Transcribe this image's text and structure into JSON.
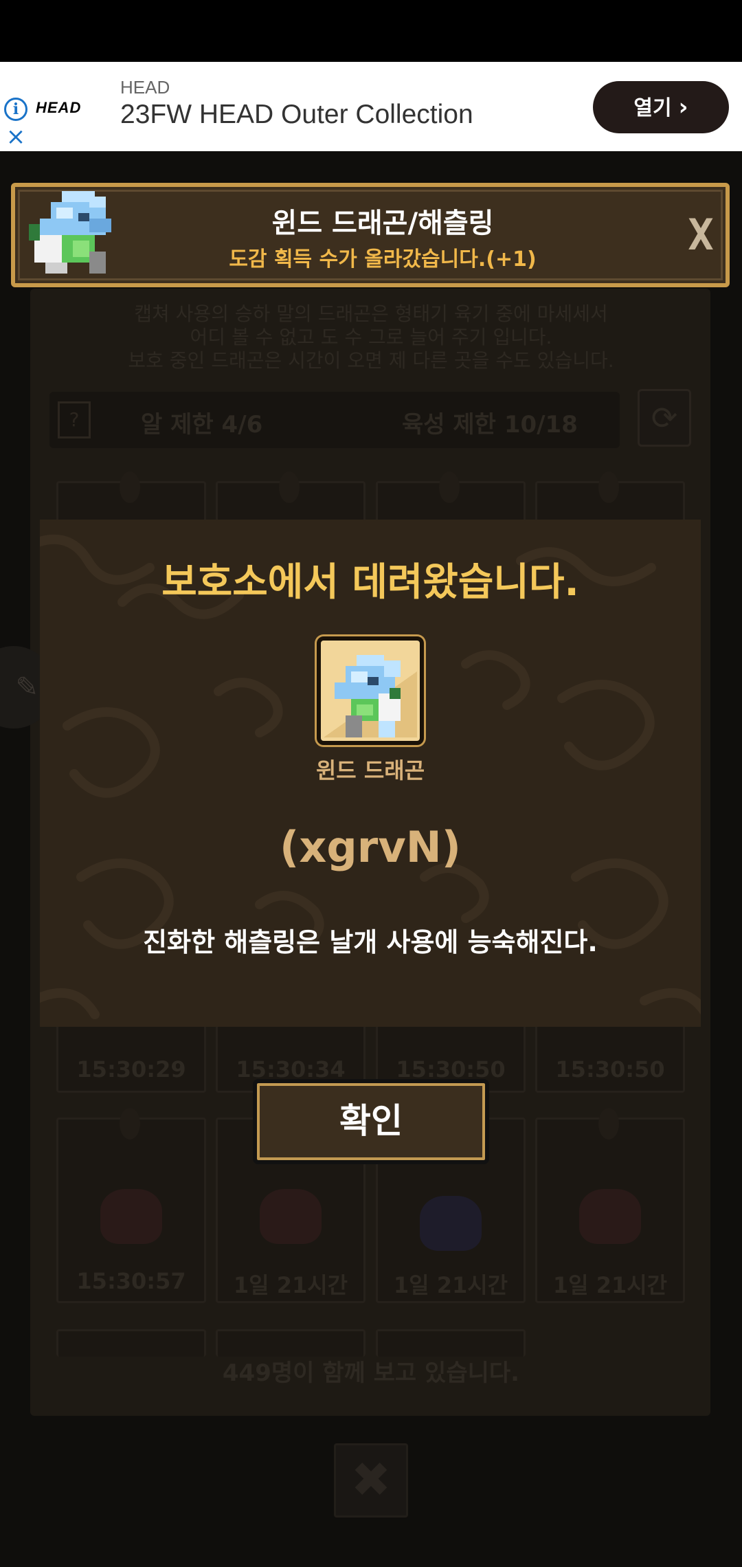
{
  "ad": {
    "brand_small": "HEAD",
    "logo_text": "HEAD",
    "title": "23FW HEAD Outer Collection",
    "cta_label": "열기",
    "info_icon": "info-icon",
    "close_icon": "close-icon"
  },
  "background": {
    "desc_line1": "캡쳐 사용의 승하 말의 드래곤은 형태기 육기 중에 마세세서",
    "desc_line2": "어디 볼 수 없고 도 수 그로 늘어 주기 입니다.",
    "desc_line3": "보호 중인 드래곤은 시간이 오면 제 다른 곳을 수도 있습니다.",
    "stat_egg_label": "알 제한",
    "stat_egg_value": "4/6",
    "stat_raise_label": "육성 제한",
    "stat_raise_value": "10/18",
    "timers_row1": [
      "15:30:29",
      "15:30:34",
      "15:30:50",
      "15:30:50"
    ],
    "timers_row2": [
      "15:30:57",
      "1일 21시간",
      "1일 21시간",
      "1일 21시간"
    ],
    "viewers": "449명이 함께 보고 있습니다."
  },
  "toast": {
    "title": "윈드 드래곤/해츨링",
    "subtitle": "도감 획득 수가 올라갔습니다.(+1)",
    "close_label": "X"
  },
  "modal": {
    "title": "보호소에서 데려왔습니다.",
    "dragon_name": "윈드 드래곤",
    "dragon_code": "(xgrvN)",
    "description": "진화한 해츨링은 날개 사용에 능숙해진다."
  },
  "confirm": {
    "label": "확인"
  },
  "close_button": {
    "label": "✖"
  },
  "colors": {
    "accent_gold": "#f4c85a",
    "toast_sub": "#f1b84a",
    "modal_bg": "#2f2519",
    "frame_gold": "#c89a4a"
  }
}
